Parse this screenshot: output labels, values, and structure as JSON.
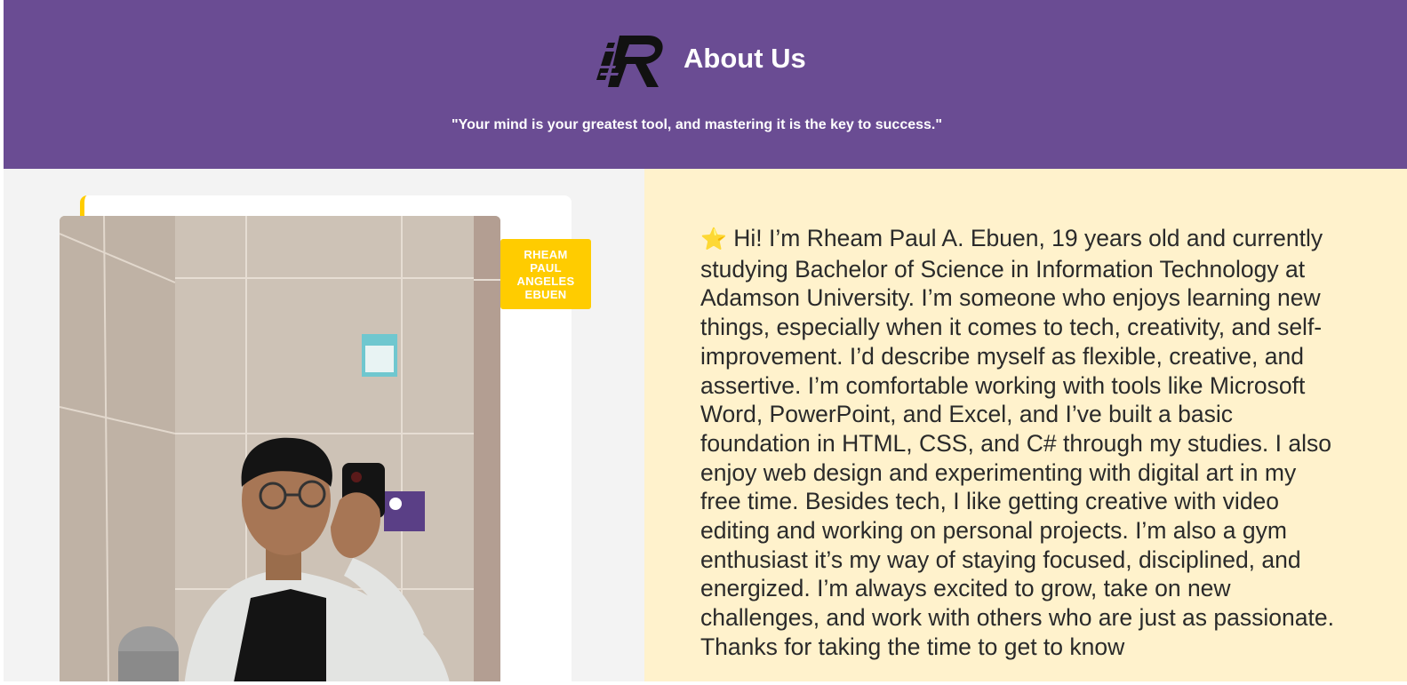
{
  "header": {
    "title": "About Us",
    "quote": "\"Your mind is your greatest tool, and mastering it is the key to success.\"",
    "logo_icon": "ir-monogram-logo-icon",
    "background_color": "#6a4c93"
  },
  "profile": {
    "name_tag": "RHEAM PAUL ANGELES EBUEN",
    "accent_color": "#ffcc00",
    "photo": "mirror-selfie-photo"
  },
  "bio": {
    "icon": "star-icon",
    "text": "Hi! I’m Rheam Paul A. Ebuen, 19 years old and currently studying Bachelor of Science in Information Technology at Adamson University. I’m someone who enjoys learning new things, especially when it comes to tech, creativity, and self-improvement. I’d describe myself as flexible, creative, and assertive. I’m comfortable working with tools like Microsoft Word, PowerPoint, and Excel, and I’ve built a basic foundation in HTML, CSS, and C# through my studies. I also enjoy web design and experimenting with digital art in my free time. Besides tech, I like getting creative with video editing and working on personal projects. I’m also a gym enthusiast it’s my way of staying focused, disciplined, and energized. I’m always excited to grow, take on new challenges, and work with others who are just as passionate. Thanks for taking the time to get to know",
    "background_color": "#fff2cc"
  }
}
